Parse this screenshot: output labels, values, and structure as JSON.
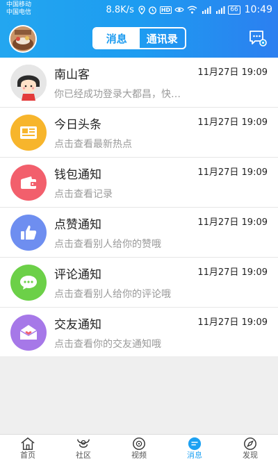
{
  "status_bar": {
    "carrier1": "中国移动",
    "carrier2": "中国电信",
    "speed": "8.8K/s",
    "hd": "HD",
    "battery": "66",
    "time": "10:49"
  },
  "header": {
    "tab_messages": "消息",
    "tab_contacts": "通讯录",
    "active_tab": "消息"
  },
  "messages": [
    {
      "title": "南山客",
      "time": "11月27日 19:09",
      "subtitle": "你已经成功登录大都昌，快…",
      "icon": "person-avatar",
      "color": "#e5e5e5"
    },
    {
      "title": "今日头条",
      "time": "11月27日 19:09",
      "subtitle": "点击查看最新热点",
      "icon": "news-icon",
      "color": "#f7b52c"
    },
    {
      "title": "钱包通知",
      "time": "11月27日 19:09",
      "subtitle": "点击查看记录",
      "icon": "wallet-icon",
      "color": "#f25f6c"
    },
    {
      "title": "点赞通知",
      "time": "11月27日 19:09",
      "subtitle": "点击查看别人给你的赞哦",
      "icon": "thumbs-up-icon",
      "color": "#6e8ef0"
    },
    {
      "title": "评论通知",
      "time": "11月27日 19:09",
      "subtitle": "点击查看别人给你的评论哦",
      "icon": "comment-icon",
      "color": "#6cd048"
    },
    {
      "title": "交友通知",
      "time": "11月27日 19:09",
      "subtitle": "点击查看你的交友通知哦",
      "icon": "envelope-icon",
      "color": "#a678e8"
    }
  ],
  "tabbar": {
    "items": [
      {
        "label": "首页",
        "icon": "home-icon"
      },
      {
        "label": "社区",
        "icon": "community-icon"
      },
      {
        "label": "视频",
        "icon": "video-icon"
      },
      {
        "label": "消息",
        "icon": "message-icon",
        "active": true
      },
      {
        "label": "发现",
        "icon": "compass-icon"
      }
    ]
  },
  "colors": {
    "header": "#1e9cf0",
    "accent": "#1da1f2",
    "background": "#efefef"
  }
}
